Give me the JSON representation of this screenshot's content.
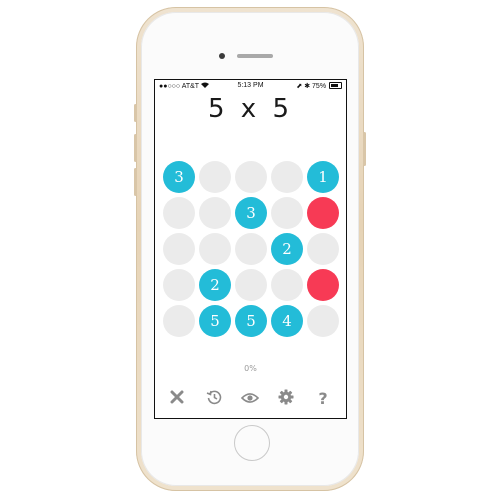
{
  "status_bar": {
    "signal": "●●○○○",
    "carrier": "AT&T",
    "time": "5:13 PM",
    "right_icons": "⬈ ✱",
    "battery": "75%"
  },
  "game": {
    "title": "5 x 5",
    "progress": "0%",
    "colors": {
      "blue": "#23bcd8",
      "red": "#f73a55",
      "empty": "#ebebeb"
    },
    "cells": [
      {
        "state": "blue",
        "label": "3"
      },
      {
        "state": "empty",
        "label": ""
      },
      {
        "state": "empty",
        "label": ""
      },
      {
        "state": "empty",
        "label": ""
      },
      {
        "state": "blue",
        "label": "1"
      },
      {
        "state": "empty",
        "label": ""
      },
      {
        "state": "empty",
        "label": ""
      },
      {
        "state": "blue",
        "label": "3"
      },
      {
        "state": "empty",
        "label": ""
      },
      {
        "state": "red",
        "label": ""
      },
      {
        "state": "empty",
        "label": ""
      },
      {
        "state": "empty",
        "label": ""
      },
      {
        "state": "empty",
        "label": ""
      },
      {
        "state": "blue",
        "label": "2"
      },
      {
        "state": "empty",
        "label": ""
      },
      {
        "state": "empty",
        "label": ""
      },
      {
        "state": "blue",
        "label": "2"
      },
      {
        "state": "empty",
        "label": ""
      },
      {
        "state": "empty",
        "label": ""
      },
      {
        "state": "red",
        "label": ""
      },
      {
        "state": "empty",
        "label": ""
      },
      {
        "state": "blue",
        "label": "5"
      },
      {
        "state": "blue",
        "label": "5"
      },
      {
        "state": "blue",
        "label": "4"
      },
      {
        "state": "empty",
        "label": ""
      }
    ]
  },
  "toolbar": {
    "icons": [
      "close-icon",
      "history-icon",
      "eye-icon",
      "gear-icon",
      "help-icon"
    ],
    "help_label": "?"
  }
}
